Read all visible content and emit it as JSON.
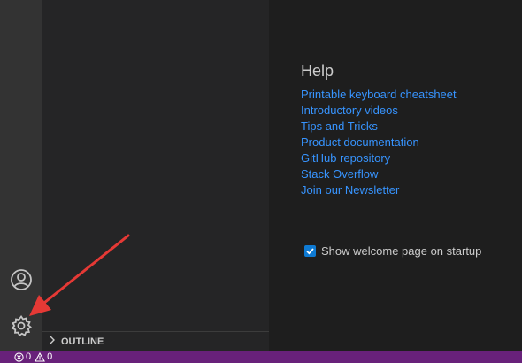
{
  "help": {
    "title": "Help",
    "links": [
      "Printable keyboard cheatsheet",
      "Introductory videos",
      "Tips and Tricks",
      "Product documentation",
      "GitHub repository",
      "Stack Overflow",
      "Join our Newsletter"
    ]
  },
  "startup": {
    "label": "Show welcome page on startup",
    "checked": true
  },
  "sidebar": {
    "outline_label": "OUTLINE"
  },
  "activity_bar": {
    "icons": [
      "account-icon",
      "gear-icon"
    ]
  },
  "status_bar": {
    "errors": "0",
    "warnings": "0",
    "background": "#68217a"
  },
  "annotation": {
    "arrow_color": "#e53935"
  },
  "colors": {
    "link": "#3794ff",
    "checkbox": "#0e7ad3"
  }
}
